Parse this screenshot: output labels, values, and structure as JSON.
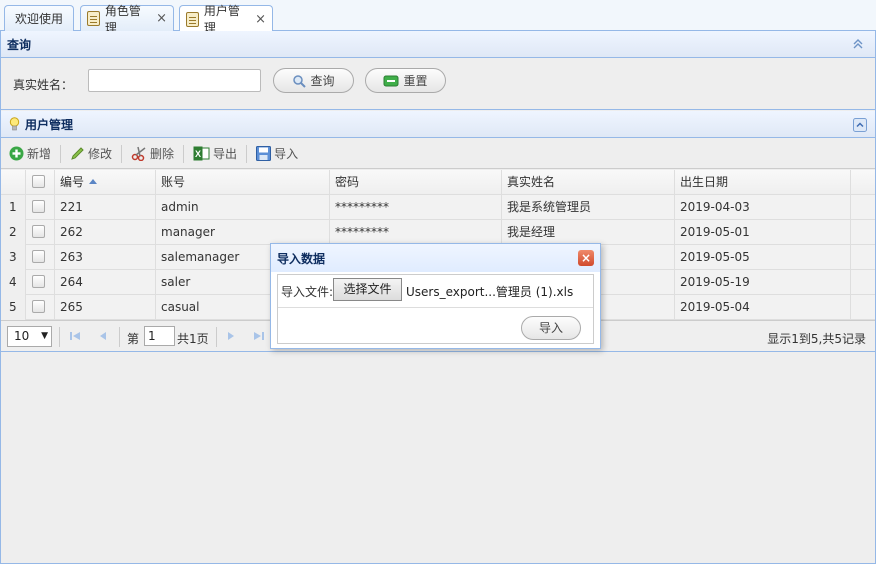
{
  "tabs": [
    {
      "label": "欢迎使用",
      "icon": ""
    },
    {
      "label": "角色管理",
      "icon": "document-icon",
      "close": "×"
    },
    {
      "label": "用户管理",
      "icon": "document-icon",
      "close": "×"
    }
  ],
  "query_panel": {
    "title": "查询",
    "label_realname": "真实姓名：",
    "realname_value": "",
    "search_label": "查询",
    "reset_label": "重置"
  },
  "user_panel": {
    "title": "用户管理",
    "toolbar": {
      "add": "新增",
      "edit": "修改",
      "delete": "删除",
      "export": "导出",
      "import": "导入"
    }
  },
  "grid": {
    "columns": [
      "编号",
      "账号",
      "密码",
      "真实姓名",
      "出生日期"
    ],
    "rows": [
      {
        "rownum": "1",
        "id": "221",
        "account": "admin",
        "password": "*********",
        "realname": "我是系统管理员",
        "birthday": "2019-04-03"
      },
      {
        "rownum": "2",
        "id": "262",
        "account": "manager",
        "password": "*********",
        "realname": "我是经理",
        "birthday": "2019-05-01"
      },
      {
        "rownum": "3",
        "id": "263",
        "account": "salemanager",
        "password": "",
        "realname": "",
        "birthday": "2019-05-05"
      },
      {
        "rownum": "4",
        "id": "264",
        "account": "saler",
        "password": "",
        "realname": "",
        "birthday": "2019-05-19"
      },
      {
        "rownum": "5",
        "id": "265",
        "account": "casual",
        "password": "",
        "realname": "",
        "birthday": "2019-05-04"
      }
    ]
  },
  "pager": {
    "page_size": "10",
    "page_prefix": "第",
    "page_value": "1",
    "page_total": "共1页",
    "info": "显示1到5,共5记录"
  },
  "dialog": {
    "title": "导入数据",
    "file_label": "导入文件:",
    "choose_file": "选择文件",
    "file_name": "Users_export...管理员 (1).xls",
    "import_label": "导入"
  },
  "colors": {
    "border": "#95b8e7",
    "header_text": "#0e2d5f",
    "close_red": "#d04a2c"
  }
}
